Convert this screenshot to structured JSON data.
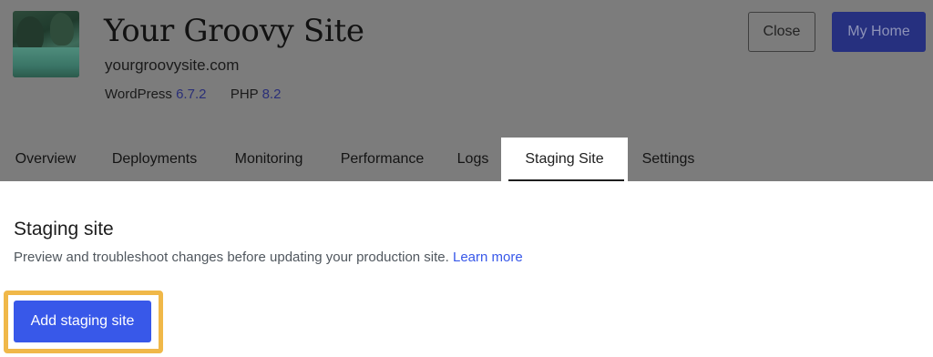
{
  "site": {
    "title": "Your Groovy Site",
    "domain": "yourgroovysite.com",
    "wordpress_label": "WordPress",
    "wordpress_version": "6.7.2",
    "php_label": "PHP",
    "php_version": "8.2",
    "thumbnail_icon": "site-thumbnail-image"
  },
  "actions": {
    "close_label": "Close",
    "home_label": "My Home"
  },
  "tabs": [
    {
      "label": "Overview",
      "active": false
    },
    {
      "label": "Deployments",
      "active": false
    },
    {
      "label": "Monitoring",
      "active": false
    },
    {
      "label": "Performance",
      "active": false
    },
    {
      "label": "Logs",
      "active": false
    },
    {
      "label": "Staging Site",
      "active": true
    },
    {
      "label": "Settings",
      "active": false
    }
  ],
  "staging": {
    "title": "Staging site",
    "description": "Preview and troubleshoot changes before updating your production site.",
    "learn_more": "Learn more",
    "add_button": "Add staging site"
  },
  "colors": {
    "overlay": "#7c7c7c",
    "primary": "#3858e9",
    "highlight": "#f0b849"
  }
}
